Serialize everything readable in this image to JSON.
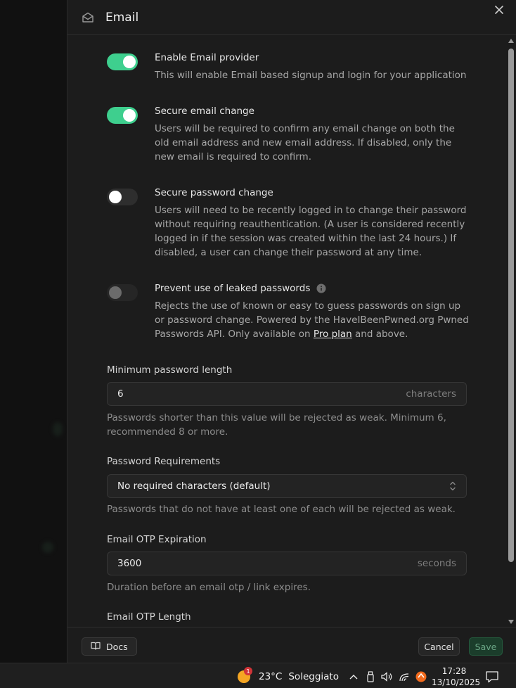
{
  "panel": {
    "title": "Email",
    "close_label": "×"
  },
  "settings": {
    "enable_email": {
      "label": "Enable Email provider",
      "description": "This will enable Email based signup and login for your application",
      "state": "on"
    },
    "secure_email_change": {
      "label": "Secure email change",
      "description": "Users will be required to confirm any email change on both the old email address and new email address. If disabled, only the new email is required to confirm.",
      "state": "on"
    },
    "secure_password_change": {
      "label": "Secure password change",
      "description": "Users will need to be recently logged in to change their password without requiring reauthentication. (A user is considered recently logged in if the session was created within the last 24 hours.) If disabled, a user can change their password at any time.",
      "state": "off"
    },
    "leaked_passwords": {
      "label": "Prevent use of leaked passwords",
      "description_prefix": "Rejects the use of known or easy to guess passwords on sign up or password change. Powered by the HaveIBeenPwned.org Pwned Passwords API. Only available on ",
      "link_text": "Pro plan",
      "description_suffix": " and above.",
      "state": "disabled"
    }
  },
  "min_password": {
    "label": "Minimum password length",
    "value": "6",
    "suffix": "characters",
    "help": "Passwords shorter than this value will be rejected as weak. Minimum 6, recommended 8 or more."
  },
  "password_requirements": {
    "label": "Password Requirements",
    "value": "No required characters (default)",
    "help": "Passwords that do not have at least one of each will be rejected as weak."
  },
  "otp_expiration": {
    "label": "Email OTP Expiration",
    "value": "3600",
    "suffix": "seconds",
    "help": "Duration before an email otp / link expires."
  },
  "otp_length": {
    "label": "Email OTP Length"
  },
  "footer": {
    "docs_label": "Docs",
    "cancel_label": "Cancel",
    "save_label": "Save"
  },
  "taskbar": {
    "weather_badge": "1",
    "temperature": "23°C",
    "weather_text": "Soleggiato",
    "time": "17:28",
    "date": "13/10/2025"
  },
  "colors": {
    "accent": "#3ecf8e",
    "panel_bg": "#1c1c1c",
    "save_bg": "#1b3d2b"
  }
}
